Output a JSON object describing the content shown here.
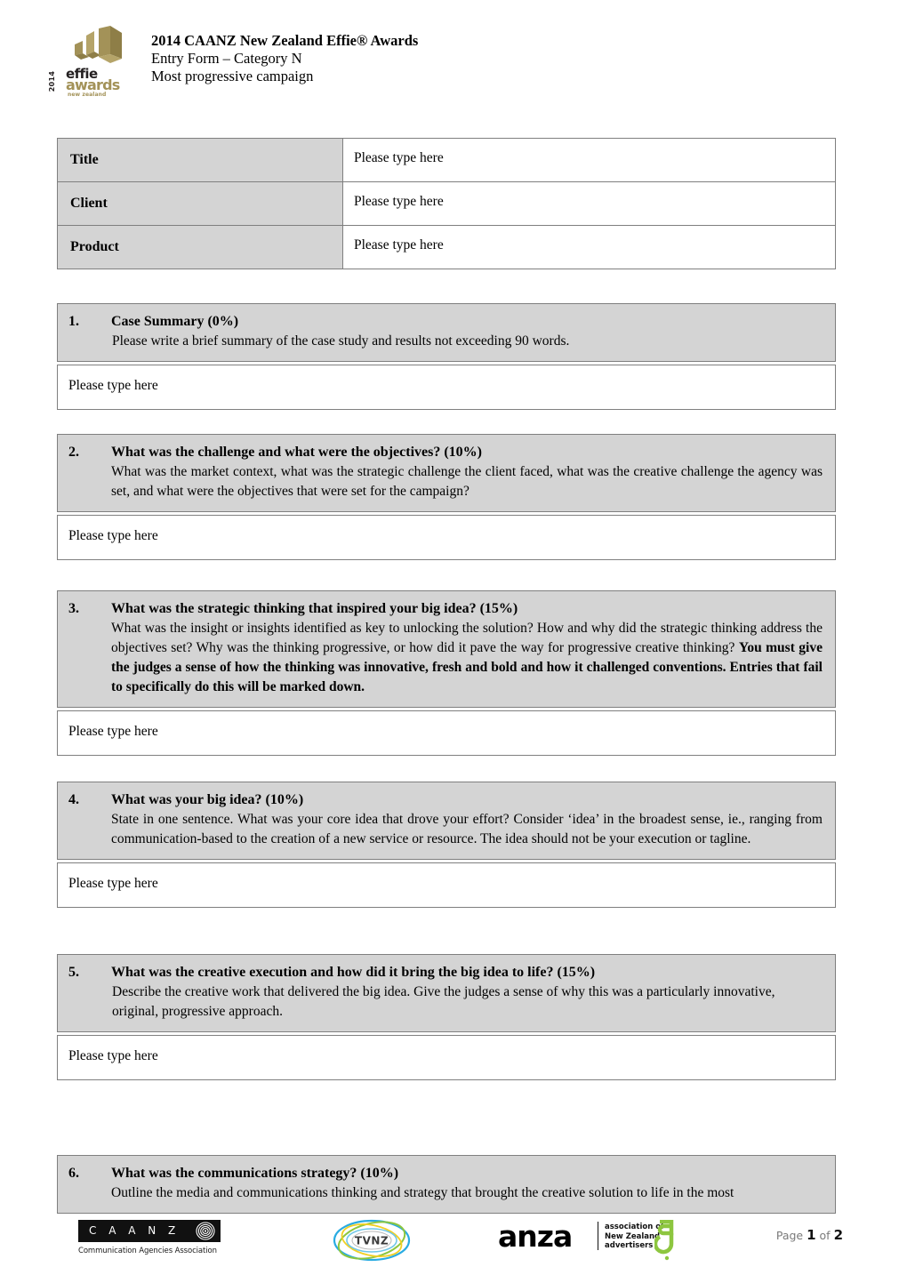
{
  "header": {
    "logo": {
      "year": "2014",
      "line1": "effie",
      "line2": "awards",
      "line3": "new zealand"
    },
    "title": "2014 CAANZ New Zealand Effie® Awards",
    "subtitle": "Entry Form – Category N",
    "category_name": "Most progressive campaign"
  },
  "identity": {
    "rows": [
      {
        "label": "Title",
        "value": "Please type here"
      },
      {
        "label": "Client",
        "value": "Please type here"
      },
      {
        "label": "Product",
        "value": "Please type here"
      }
    ]
  },
  "sections": [
    {
      "number": "1.",
      "title": "Case Summary (0%)",
      "description": "Please write a brief summary of the case study and results not exceeding 90 words.",
      "answer": "Please type here"
    },
    {
      "number": "2.",
      "title": "What was the challenge and what were the objectives? (10%)",
      "description": "What was the market context, what was the strategic challenge the client faced, what was the creative challenge the agency was set, and what were the objectives that were set for the campaign?",
      "answer": "Please type here"
    },
    {
      "number": "3.",
      "title": "What was the strategic thinking that inspired your big idea? (15%)",
      "description": "What was the insight or insights identified as key to unlocking the solution? How and why did the strategic thinking address the objectives set?  Why was the thinking progressive, or how did it pave the way for progressive creative thinking?  ",
      "description_bold": "You must give the judges a sense of how the thinking was innovative, fresh and bold and how it challenged conventions.  Entries that fail to specifically do this will be marked down.",
      "answer": "Please type here"
    },
    {
      "number": "4.",
      "title": "What was your big idea? (10%)",
      "description": "State in one sentence. What was your core idea that drove your effort?  Consider ‘idea’ in the broadest sense, ie., ranging from communication-based to the creation of a new service or resource.  The idea should not be your execution or tagline.",
      "answer": "Please type here"
    },
    {
      "number": "5.",
      "title": "What was the creative execution and how did it bring the big idea to life?  (15%)",
      "description": "Describe the creative work that delivered the big idea. Give the judges a sense of why this was a particularly innovative, original, progressive approach.",
      "answer": "Please type here"
    },
    {
      "number": "6.",
      "title": "What was the communications strategy? (10%)",
      "description": "Outline the media and communications thinking and strategy that brought the creative solution to life in the most",
      "answer": ""
    }
  ],
  "footer": {
    "caanz": {
      "letters": "C A A N Z",
      "subtitle": "Communication Agencies Association"
    },
    "tvnz": {
      "wordmark": "TVNZ"
    },
    "anza": {
      "wordmark": "anza",
      "sub_line1": "association of",
      "sub_line2": "New Zealand",
      "sub_line3": "advertisers"
    },
    "page_label": "Page",
    "page_current": "1",
    "page_of": "of",
    "page_total": "2"
  },
  "colors": {
    "effie_gold": "#a39258",
    "box_grey": "#d4d4d4",
    "border_grey": "#7f7f7f",
    "anza_green": "#8dc63f",
    "tvnz_blue": "#29abe2"
  }
}
